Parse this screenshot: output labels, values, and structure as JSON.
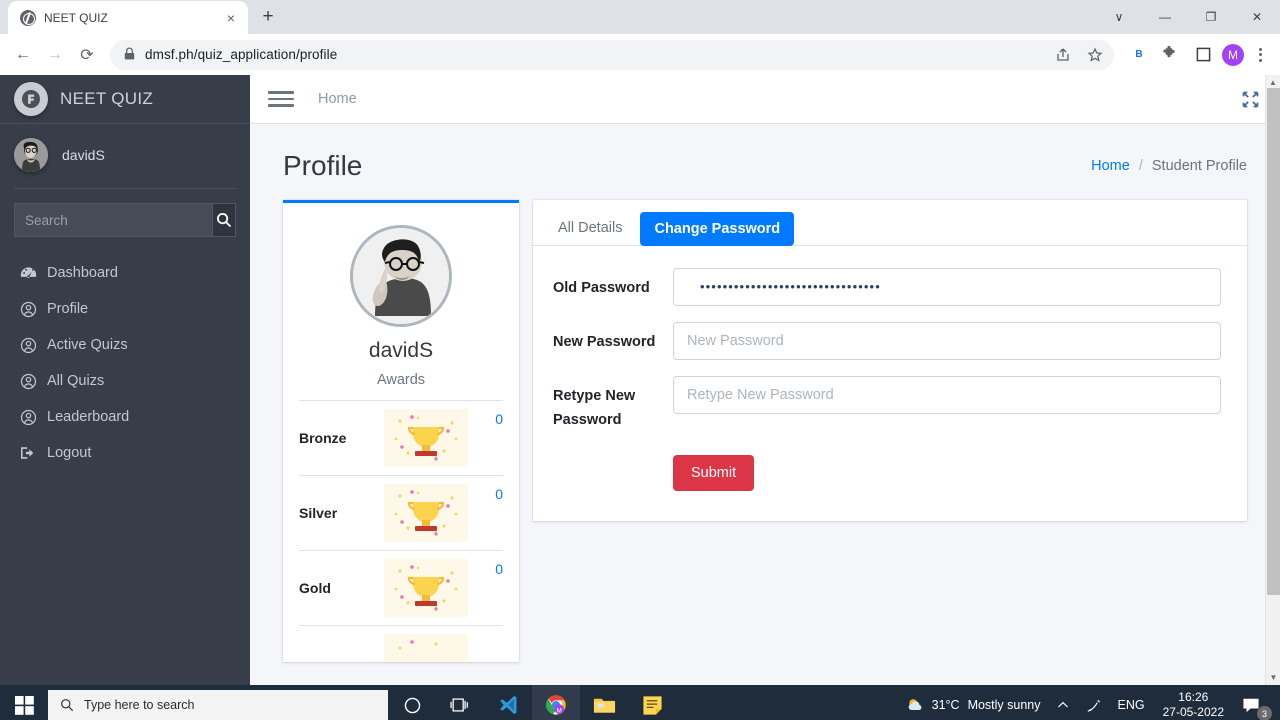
{
  "browser": {
    "tab_title": "NEET QUIZ",
    "tab_close": "×",
    "new_tab": "+",
    "window_controls": {
      "minimize_down": "∨",
      "minimize": "—",
      "maximize": "❐",
      "close": "✕"
    },
    "nav": {
      "back": "←",
      "forward": "→",
      "reload": "⟳"
    },
    "url": "dmsf.ph/quiz_application/profile",
    "lock_icon": "🔒",
    "extension_b": "B",
    "profile_initial": "M"
  },
  "sidebar": {
    "brand": "NEET QUIZ",
    "user": "davidS",
    "search_placeholder": "Search",
    "search_value": "",
    "items": [
      {
        "label": "Dashboard",
        "icon": "dashboard-icon"
      },
      {
        "label": "Profile",
        "icon": "user-circle-icon"
      },
      {
        "label": "Active Quizs",
        "icon": "user-circle-icon"
      },
      {
        "label": "All Quizs",
        "icon": "user-circle-icon"
      },
      {
        "label": "Leaderboard",
        "icon": "user-circle-icon"
      },
      {
        "label": "Logout",
        "icon": "logout-icon"
      }
    ]
  },
  "topnav": {
    "home_label": "Home"
  },
  "page": {
    "title": "Profile",
    "breadcrumb_home": "Home",
    "breadcrumb_sep": "/",
    "breadcrumb_current": "Student Profile"
  },
  "profile_card": {
    "name": "davidS",
    "subtitle": "Awards",
    "awards": [
      {
        "name": "Bronze",
        "count": "0"
      },
      {
        "name": "Silver",
        "count": "0"
      },
      {
        "name": "Gold",
        "count": "0"
      },
      {
        "name": "",
        "count": ""
      }
    ]
  },
  "form_card": {
    "tabs": [
      {
        "label": "All Details",
        "active": false
      },
      {
        "label": "Change Password",
        "active": true
      }
    ],
    "fields": [
      {
        "label": "Old Password",
        "value": "••••••••••••••••••••••••••••••••",
        "placeholder": "Old Password"
      },
      {
        "label": "New Password",
        "value": "",
        "placeholder": "New Password"
      },
      {
        "label": "Retype New Password",
        "value": "",
        "placeholder": "Retype New Password"
      }
    ],
    "submit_label": "Submit"
  },
  "taskbar": {
    "search_placeholder": "Type here to search",
    "weather_temp": "31°C",
    "weather_desc": "Mostly sunny",
    "language": "ENG",
    "time": "16:26",
    "date": "27-05-2022",
    "notification_count": "3"
  },
  "colors": {
    "sidebar": "#373d49",
    "accent_blue": "#007bff",
    "danger_red": "#dc3545",
    "taskbar": "#1f2c3c"
  }
}
